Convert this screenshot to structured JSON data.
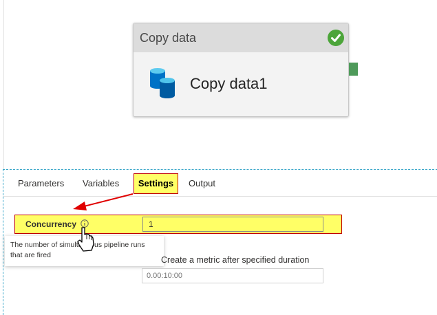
{
  "activity": {
    "type_label": "Copy data",
    "name": "Copy data1",
    "status_icon": "check-circle-icon",
    "status_color": "#4ca53a",
    "icon": "database-icon",
    "icon_color": "#0078d4"
  },
  "tabs": [
    {
      "label": "Parameters"
    },
    {
      "label": "Variables"
    },
    {
      "label": "Settings",
      "selected": true
    },
    {
      "label": "Output"
    }
  ],
  "settings": {
    "concurrency_label": "Concurrency",
    "concurrency_value": "1",
    "tooltip": "The number of simultaneous pipeline runs that are fired",
    "metric_checkbox_label": "Create a metric after specified duration",
    "duration_placeholder": "0.00:10:00"
  },
  "highlight_color": "#ffff66",
  "annotation_color": "#e00000"
}
